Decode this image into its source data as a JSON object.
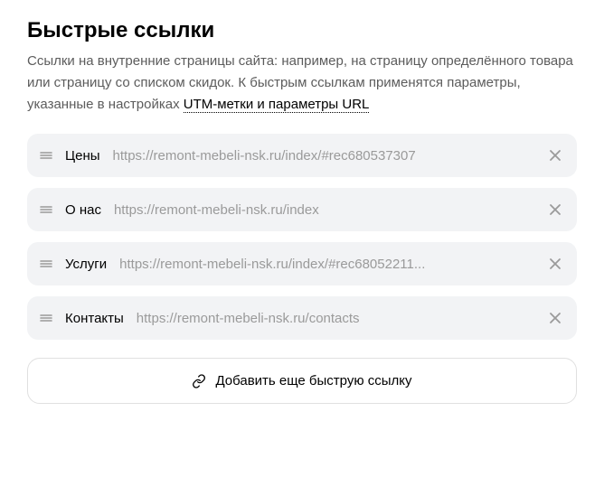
{
  "heading": "Быстрые ссылки",
  "description_prefix": "Ссылки на внутренние страницы сайта: например, на страницу определённого товара или страницу со списком скидок. К быстрым ссылкам применятся параметры, указанные в настройках ",
  "description_link": "UTM-метки и параметры URL",
  "items": [
    {
      "label": "Цены",
      "url": "https://remont-mebeli-nsk.ru/index/#rec680537307"
    },
    {
      "label": "О нас",
      "url": "https://remont-mebeli-nsk.ru/index"
    },
    {
      "label": "Услуги",
      "url": "https://remont-mebeli-nsk.ru/index/#rec68052211..."
    },
    {
      "label": "Контакты",
      "url": "https://remont-mebeli-nsk.ru/contacts"
    }
  ],
  "add_button_label": "Добавить еще быструю ссылку"
}
